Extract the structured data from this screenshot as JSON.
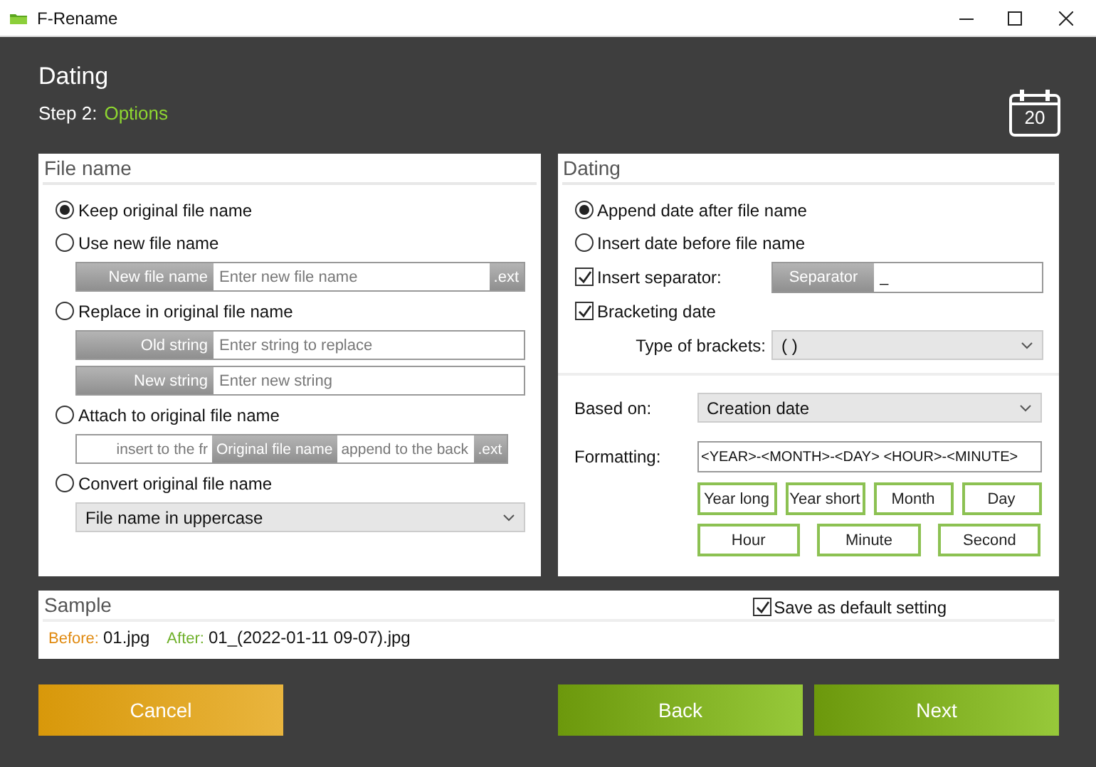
{
  "window": {
    "title": "F-Rename"
  },
  "header": {
    "title": "Dating",
    "step_label": "Step 2:",
    "step_name": "Options",
    "calendar_day": "20"
  },
  "file_name_panel": {
    "title": "File name",
    "options": [
      {
        "label": "Keep original file name",
        "selected": true
      },
      {
        "label": "Use new file name",
        "selected": false,
        "rows": [
          [
            {
              "kind": "tag",
              "text": "New file name"
            },
            {
              "kind": "input",
              "placeholder": "Enter new file name"
            },
            {
              "kind": "ext",
              "text": ".ext"
            }
          ]
        ]
      },
      {
        "label": "Replace in original file name",
        "selected": false,
        "rows": [
          [
            {
              "kind": "tag",
              "text": "Old string"
            },
            {
              "kind": "input",
              "placeholder": "Enter string to replace"
            }
          ],
          [
            {
              "kind": "tag",
              "text": "New string"
            },
            {
              "kind": "input",
              "placeholder": "Enter new string"
            }
          ]
        ]
      },
      {
        "label": "Attach to original file name",
        "selected": false,
        "rows": [
          [
            {
              "kind": "input",
              "placeholder": "insert to the fr"
            },
            {
              "kind": "tag",
              "text": "Original file name"
            },
            {
              "kind": "input",
              "placeholder": "append to the back"
            },
            {
              "kind": "ext",
              "text": ".ext"
            }
          ]
        ]
      },
      {
        "label": "Convert original file name",
        "selected": false,
        "select": "File name in uppercase"
      }
    ]
  },
  "dating_panel": {
    "title": "Dating",
    "positions": [
      {
        "label": "Append date after file name",
        "selected": true
      },
      {
        "label": "Insert date before file name",
        "selected": false
      }
    ],
    "separator": {
      "label": "Insert separator:",
      "checked": true,
      "tag": "Separator",
      "value": "_"
    },
    "bracketing": {
      "label": "Bracketing date",
      "checked": true,
      "type_label": "Type of brackets:",
      "type_value": "( )"
    },
    "based_on": {
      "label": "Based on:",
      "value": "Creation date"
    },
    "formatting": {
      "label": "Formatting:",
      "value": "<YEAR>-<MONTH>-<DAY> <HOUR>-<MINUTE>"
    },
    "format_buttons": [
      [
        "Year long",
        "Year short",
        "Month",
        "Day"
      ],
      [
        "Hour",
        "Minute",
        "Second"
      ]
    ]
  },
  "sample": {
    "title": "Sample",
    "save_default": {
      "label": "Save as default setting",
      "checked": true
    },
    "before_label": "Before:",
    "before_value": "01.jpg",
    "after_label": "After:",
    "after_value": "01_(2022-01-11 09-07).jpg"
  },
  "footer_buttons": [
    {
      "kind": "cancel",
      "label": "Cancel"
    },
    {
      "kind": "back",
      "label": "Back"
    },
    {
      "kind": "next",
      "label": "Next"
    }
  ]
}
